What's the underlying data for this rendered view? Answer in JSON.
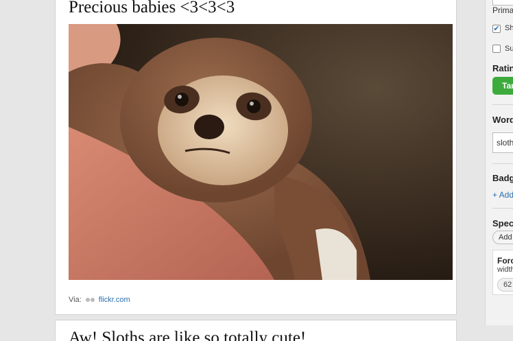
{
  "posts": [
    {
      "title": "Precious babies <3<3<3",
      "image_alt": "baby sloth",
      "via_label": "Via:",
      "via_link": "flickr.com"
    },
    {
      "title": "Aw! Sloths are like so totally cute!"
    }
  ],
  "sidebar": {
    "primary_label": "Prima",
    "checkbox_1_label": "Sh",
    "checkbox_2_label": "Su",
    "rating_heading": "Ratin",
    "rating_button": "Tar",
    "words_heading": "Word",
    "words_input_value": "sloth",
    "badges_heading": "Badg",
    "add_badge_link": "+ Add",
    "special_heading": "Spec",
    "special_pill": "Add",
    "card_title": "Forc",
    "card_sub": "width",
    "card_value": "62"
  },
  "colors": {
    "link": "#2a6fb0",
    "green": "#3cab3c",
    "page_bg": "#e6e6e6"
  }
}
